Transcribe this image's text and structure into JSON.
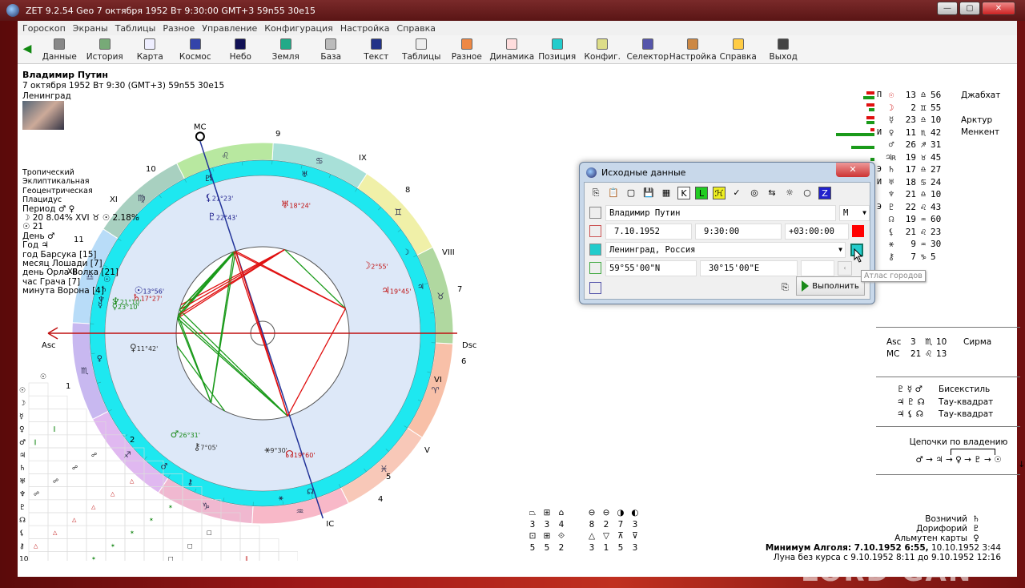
{
  "window": {
    "title": "ZET 9.2.54 Geo    7 октября 1952  Вт   9:30:00 GMT+3 59n55  30e15",
    "controls": [
      "—",
      "▢",
      "✕"
    ]
  },
  "menu": [
    "Гороскоп",
    "Экраны",
    "Таблицы",
    "Разное",
    "Управление",
    "Конфигурация",
    "Настройка",
    "Справка"
  ],
  "toolbar": [
    {
      "label": "Данные",
      "color": "#888"
    },
    {
      "label": "История",
      "color": "#7a7"
    },
    {
      "label": "Карта",
      "color": "#eef"
    },
    {
      "label": "Космос",
      "color": "#34a"
    },
    {
      "label": "Небо",
      "color": "#115"
    },
    {
      "label": "Земля",
      "color": "#2a8"
    },
    {
      "label": "База",
      "color": "#bbb"
    },
    {
      "label": "Текст",
      "color": "#238"
    },
    {
      "label": "Таблицы",
      "color": "#eee"
    },
    {
      "label": "Разное",
      "color": "#e84"
    },
    {
      "label": "Динамика",
      "color": "#fdd"
    },
    {
      "label": "Позиция",
      "color": "#2cc"
    },
    {
      "label": "Конфиг.",
      "color": "#dd8"
    },
    {
      "label": "Селектор",
      "color": "#55a"
    },
    {
      "label": "Настройка",
      "color": "#c84"
    },
    {
      "label": "Справка",
      "color": "#fc4"
    },
    {
      "label": "Выход",
      "color": "#444"
    }
  ],
  "person": {
    "name": "Владимир Путин",
    "date_line": "7 октября 1952  Вт   9:30 (GMT+3) 59n55  30e15",
    "place": "Ленинград"
  },
  "settings": [
    "Тропический",
    "Эклиптикальная",
    "Геоцентрическая",
    "Плацидус"
  ],
  "periods": [
    "Период ♂ ♀",
    "☽  20 8.04%  XVI  ♉ ☉ 2.18%",
    "☉  21",
    "День ♂",
    "Год ♃",
    "год Барсука [15]",
    "месяц Лошади [7]",
    "день Орла-Волка [21]",
    "час Грача [7]",
    "минута Ворона [4]"
  ],
  "chart": {
    "asc_lon": 213.17,
    "mc_lon": 141.22,
    "angle_labels": {
      "asc": "Asc",
      "dsc": "Dsc",
      "mc": "MC",
      "ic": "IC"
    },
    "house_labels": [
      "1",
      "XII",
      "11",
      "XI",
      "10",
      "9",
      "IX",
      "8",
      "VIII",
      "7",
      "VI",
      "6",
      "V",
      "5",
      "4",
      "2"
    ],
    "sign_glyphs": [
      "♈",
      "♉",
      "♊",
      "♋",
      "♌",
      "♍",
      "♎",
      "♏",
      "♐",
      "♑",
      "♒",
      "♓"
    ],
    "sign_colors": [
      "#f8c0a8",
      "#b0d8a0",
      "#f0f0a8",
      "#a8e0d8",
      "#b8e8a0",
      "#a8d0c0",
      "#b8dcf8",
      "#c8b8f0",
      "#e0b8f0",
      "#f0b8d0",
      "#f8b8c8",
      "#f8c8b8"
    ],
    "planets": [
      {
        "glyph": "☉",
        "lon": 193.93,
        "label": "13°56'",
        "color": "#1a1a8a"
      },
      {
        "glyph": "☽",
        "lon": 62.92,
        "label": "2°55'",
        "color": "#c01010"
      },
      {
        "glyph": "☿",
        "lon": 203.17,
        "label": "23°10'",
        "color": "#1a8a1a"
      },
      {
        "glyph": "♀",
        "lon": 221.7,
        "label": "11°42'",
        "color": "#333"
      },
      {
        "glyph": "♂",
        "lon": 266.52,
        "label": "26°31'",
        "color": "#1a8a1a"
      },
      {
        "glyph": "♃",
        "lon": 49.75,
        "label": "19°45'",
        "color": "#c01010"
      },
      {
        "glyph": "♄",
        "lon": 197.45,
        "label": "17°27'",
        "color": "#c01010"
      },
      {
        "glyph": "♅",
        "lon": 108.4,
        "label": "18°24'",
        "color": "#c01010"
      },
      {
        "glyph": "♆",
        "lon": 201.17,
        "label": "21°10'",
        "color": "#1a8a1a"
      },
      {
        "glyph": "♇",
        "lon": 142.72,
        "label": "22°43'",
        "color": "#1a1a8a"
      },
      {
        "glyph": "☊",
        "lon": 319.99,
        "label": "19°60'",
        "color": "#c01010"
      },
      {
        "glyph": "⚸",
        "lon": 141.38,
        "label": "21°23'",
        "color": "#1a1a8a"
      },
      {
        "glyph": "⚹",
        "lon": 309.5,
        "label": "9°30'",
        "color": "#333"
      },
      {
        "glyph": "⚷",
        "lon": 277.08,
        "label": "7°05'",
        "color": "#333"
      }
    ],
    "aspect_colors": {
      "hard": "#e01010",
      "soft": "#1a9a1a"
    }
  },
  "aspect_grid": {
    "row_glyphs": [
      "☉",
      "☽",
      "☿",
      "♀",
      "♂",
      "♃",
      "♄",
      "♅",
      "♆",
      "♇",
      "☊",
      "⚸",
      "⚷",
      "10"
    ]
  },
  "planet_table": [
    {
      "dignity": "П",
      "glyph": "☉",
      "deg": "13",
      "sign": "♎",
      "min": "56",
      "star": "Джабхат",
      "green": 0.3,
      "red": 0.2
    },
    {
      "dignity": "",
      "glyph": "☽",
      "deg": "2",
      "sign": "♊",
      "min": "55",
      "star": "",
      "green": 0.15,
      "red": 0.2
    },
    {
      "dignity": "",
      "glyph": "☿",
      "deg": "23",
      "sign": "♎",
      "min": "10",
      "star": "Арктур",
      "green": 0.2,
      "red": 0.2
    },
    {
      "dignity": "И",
      "glyph": "♀",
      "deg": "11",
      "sign": "♏",
      "min": "42",
      "star": "Менкент",
      "green": 1.0,
      "red": 0.1
    },
    {
      "dignity": "",
      "glyph": "♂",
      "deg": "26",
      "sign": "♐",
      "min": "31",
      "star": "",
      "green": 0.6,
      "red": 0
    },
    {
      "dignity": "",
      "glyph": "♃ʀ",
      "deg": "19",
      "sign": "♉",
      "min": "45",
      "star": "",
      "green": 0.1,
      "red": 0
    },
    {
      "dignity": "Э",
      "glyph": "♄",
      "deg": "17",
      "sign": "♎",
      "min": "27",
      "star": "",
      "green": 0,
      "red": 0
    },
    {
      "dignity": "И",
      "glyph": "♅",
      "deg": "18",
      "sign": "♋",
      "min": "24",
      "star": "",
      "green": 0,
      "red": 0
    },
    {
      "dignity": "",
      "glyph": "♆",
      "deg": "21",
      "sign": "♎",
      "min": "10",
      "star": "",
      "green": 0,
      "red": 0
    },
    {
      "dignity": "Э",
      "glyph": "♇",
      "deg": "22",
      "sign": "♌",
      "min": "43",
      "star": "",
      "green": 0,
      "red": 0
    },
    {
      "dignity": "",
      "glyph": "☊",
      "deg": "19",
      "sign": "♒",
      "min": "60",
      "star": "",
      "green": 0,
      "red": 0
    },
    {
      "dignity": "",
      "glyph": "⚸",
      "deg": "21",
      "sign": "♌",
      "min": "23",
      "star": "",
      "green": 0,
      "red": 0
    },
    {
      "dignity": "",
      "glyph": "⚹",
      "deg": "9",
      "sign": "♒",
      "min": "30",
      "star": "",
      "green": 0,
      "red": 0
    },
    {
      "dignity": "",
      "glyph": "⚷",
      "deg": "7",
      "sign": "♑",
      "min": "5",
      "star": "",
      "green": 0,
      "red": 0
    }
  ],
  "angles": [
    {
      "name": "Asc",
      "deg": "3",
      "sign": "♏",
      "min": "10",
      "star": "Сирма"
    },
    {
      "name": "MC",
      "deg": "21",
      "sign": "♌",
      "min": "13",
      "star": ""
    }
  ],
  "figures": [
    {
      "glyphs": "♇ ☿ ♂",
      "name": "Бисекстиль"
    },
    {
      "glyphs": "♃ ♇ ☊",
      "name": "Тау-квадрат"
    },
    {
      "glyphs": "♃ ⚸ ☊",
      "name": "Тау-квадрат"
    }
  ],
  "chains": {
    "title": "Цепочки по владению",
    "chain": "♂ → ♃ → ♀ → ♇ → ☉",
    "scroll": "↓"
  },
  "rulers": [
    {
      "label": "Возничий",
      "glyph": "♄"
    },
    {
      "label": "Дорифорий",
      "glyph": "♇"
    },
    {
      "label": "Альмутен карты",
      "glyph": "♀"
    }
  ],
  "algol": {
    "bold": "Минимум Алголя: 7.10.1952  6:55,",
    "rest": " 10.10.1952  3:44"
  },
  "moon_void": "Луна без курса с 9.10.1952  8:11 до 9.10.1952 12:16",
  "counts": {
    "top_glyphs": [
      "⏢",
      "⊞",
      "⌂",
      "",
      "⊖",
      "⊖",
      "◑",
      "◐"
    ],
    "top_values": [
      "3",
      "3",
      "4",
      "",
      "8",
      "2",
      "7",
      "3"
    ],
    "bottom_glyphs": [
      "⊡",
      "⊞",
      "⟐",
      "",
      "△",
      "▽",
      "⊼",
      "⊽"
    ],
    "bottom_values": [
      "5",
      "5",
      "2",
      "",
      "3",
      "1",
      "5",
      "3"
    ]
  },
  "dialog": {
    "title": "Исходные данные",
    "close": "✕",
    "tools": [
      "⎘",
      "📋",
      "▢",
      "💾",
      "▦",
      "K",
      "L",
      "ℋ",
      "✓",
      "◎",
      "⇆",
      "☼",
      "○",
      "Z"
    ],
    "name": "Владимир Путин",
    "gender": "М",
    "date": "7.10.1952",
    "time": "9:30:00",
    "tz": "+03:00:00",
    "place": "Ленинград, Россия",
    "lat": "59°55'00\"N",
    "lon": "30°15'00\"E",
    "extra": "",
    "run": "Выполнить",
    "tooltip": "Атлас городов"
  },
  "watermark": "LORD GAN"
}
